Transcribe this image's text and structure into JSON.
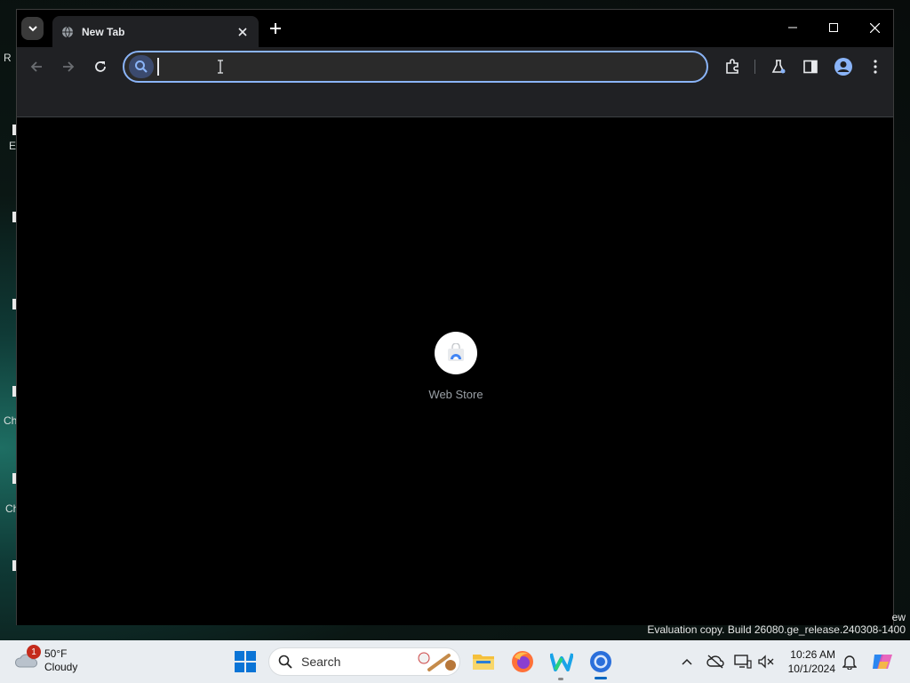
{
  "desktop": {
    "left_glyphs": [
      "R",
      "E",
      "Ch",
      "Ch"
    ]
  },
  "browser": {
    "tab": {
      "title": "New Tab",
      "favicon": "globe-icon"
    },
    "omnibox": {
      "value": "",
      "placeholder": ""
    },
    "shortcuts": [
      {
        "label": "Web Store",
        "icon": "web-store-icon"
      }
    ],
    "accent": "#8ab4f8"
  },
  "watermark": {
    "line1": "ew",
    "line2": "Evaluation copy. Build 26080.ge_release.240308-1400"
  },
  "taskbar": {
    "weather": {
      "badge": "1",
      "temp": "50°F",
      "condition": "Cloudy"
    },
    "search_label": "Search",
    "clock": {
      "time": "10:26 AM",
      "date": "10/1/2024"
    }
  }
}
